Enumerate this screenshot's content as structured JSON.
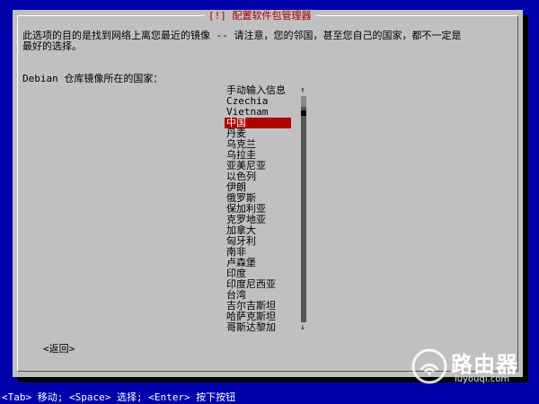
{
  "dialog": {
    "title": "[!] 配置软件包管理器",
    "message": "此选项的目的是找到网络上离您最近的镜像 -- 请注意，您的邻国，甚至您自己的国家，都不一定是\n最好的选择。",
    "prompt": "Debian 仓库镜像所在的国家："
  },
  "country_list": {
    "items": [
      "手动输入信息",
      "Czechia",
      "Vietnam",
      "中国",
      "丹麦",
      "乌克兰",
      "乌拉圭",
      "亚美尼亚",
      "以色列",
      "伊朗",
      "俄罗斯",
      "保加利亚",
      "克罗地亚",
      "加拿大",
      "匈牙利",
      "南非",
      "卢森堡",
      "印度",
      "印度尼西亚",
      "台湾",
      "吉尔吉斯坦",
      "哈萨克斯坦",
      "哥斯达黎加"
    ],
    "selected": "中国"
  },
  "scrollbar": {
    "up_arrow": "↑",
    "down_arrow": "↓"
  },
  "buttons": {
    "back": "<返回>"
  },
  "statusbar": {
    "text": "<Tab> 移动; <Space> 选择; <Enter> 按下按钮"
  },
  "watermark": {
    "name": "路由器",
    "url": "luyouqi.com"
  },
  "colors": {
    "background": "#0000aa",
    "dialog": "#c0c0c0",
    "selected": "#aa0000",
    "title": "#aa0000"
  }
}
